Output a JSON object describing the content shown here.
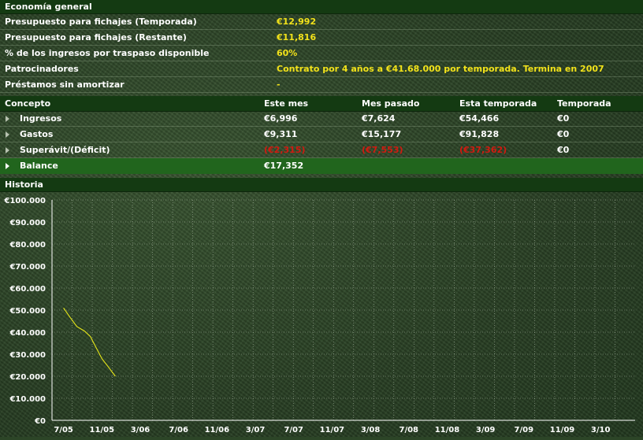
{
  "overview": {
    "title": "Economía general",
    "rows": [
      {
        "label": "Presupuesto para fichajes (Temporada)",
        "value": "€12,992"
      },
      {
        "label": "Presupuesto para fichajes (Restante)",
        "value": "€11,816"
      },
      {
        "label": "% de los ingresos por traspaso disponible",
        "value": "60%"
      },
      {
        "label": "Patrocinadores",
        "value": "Contrato por 4 años a €41.68.000 por temporada. Termina en 2007"
      },
      {
        "label": "Préstamos sin amortizar",
        "value": "-"
      }
    ]
  },
  "finance_table": {
    "headers": [
      "Concepto",
      "Este mes",
      "Mes pasado",
      "Esta temporada",
      "Temporada"
    ],
    "rows": [
      {
        "concept": "Ingresos",
        "this_month": "€6,996",
        "last_month": "€7,624",
        "this_season": "€54,466",
        "season": "€0"
      },
      {
        "concept": "Gastos",
        "this_month": "€9,311",
        "last_month": "€15,177",
        "this_season": "€91,828",
        "season": "€0"
      },
      {
        "concept": "Superávit/(Déficit)",
        "this_month": "(€2,315)",
        "last_month": "(€7,553)",
        "this_season": "(€37,362)",
        "season": "€0"
      }
    ],
    "balance": {
      "concept": "Balance",
      "value": "€17,352"
    }
  },
  "history": {
    "title": "Historia"
  },
  "chart_data": {
    "type": "line",
    "y_ticks": [
      "€100.000",
      "€90.000",
      "€80.000",
      "€70.000",
      "€60.000",
      "€50.000",
      "€40.000",
      "€30.000",
      "€20.000",
      "€10.000",
      "€0"
    ],
    "x_ticks": [
      "7/05",
      "11/05",
      "3/06",
      "7/06",
      "11/06",
      "3/07",
      "7/07",
      "11/07",
      "3/08",
      "7/08",
      "11/08",
      "3/09",
      "7/09",
      "11/09",
      "3/10"
    ],
    "ylim": [
      0,
      100000
    ],
    "grid": true,
    "series": [
      {
        "color": "#e6e619",
        "points": [
          [
            0,
            51000
          ],
          [
            0.18,
            46500
          ],
          [
            0.35,
            42500
          ],
          [
            0.55,
            40500
          ],
          [
            0.7,
            38000
          ],
          [
            0.85,
            33000
          ],
          [
            1.0,
            28000
          ],
          [
            1.2,
            23500
          ],
          [
            1.35,
            20000
          ]
        ]
      }
    ],
    "colors": {
      "line": "#e6e619",
      "grid": "#c9d2c4",
      "axis": "#ffffff"
    }
  }
}
